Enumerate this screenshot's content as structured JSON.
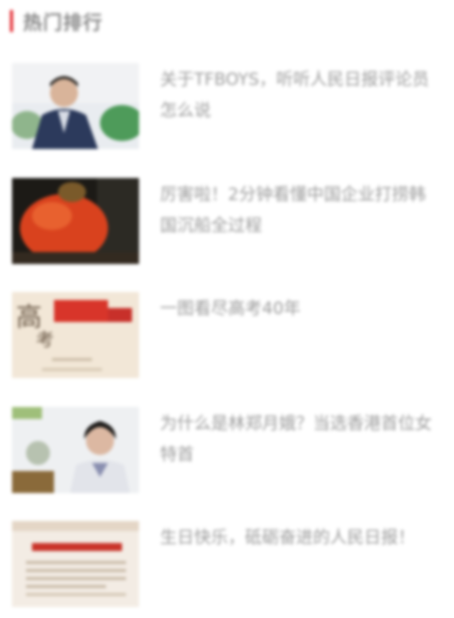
{
  "section": {
    "title": "热门排行",
    "accent_color": "#e3242b"
  },
  "articles": [
    {
      "title": "关于TFBOYS，听听人民日报评论员怎么说",
      "thumb": "man-in-suit-photo"
    },
    {
      "title": "厉害啦！2分钟看懂中国企业打捞韩国沉船全过程",
      "thumb": "salvage-ship-photo"
    },
    {
      "title": "一图看尽高考40年",
      "thumb": "gaokao-infographic"
    },
    {
      "title": "为什么是林郑月娥？当选香港首位女特首",
      "thumb": "carrie-lam-photo"
    },
    {
      "title": "生日快乐，砥砺奋进的人民日报！",
      "thumb": "newspaper-photo"
    }
  ]
}
